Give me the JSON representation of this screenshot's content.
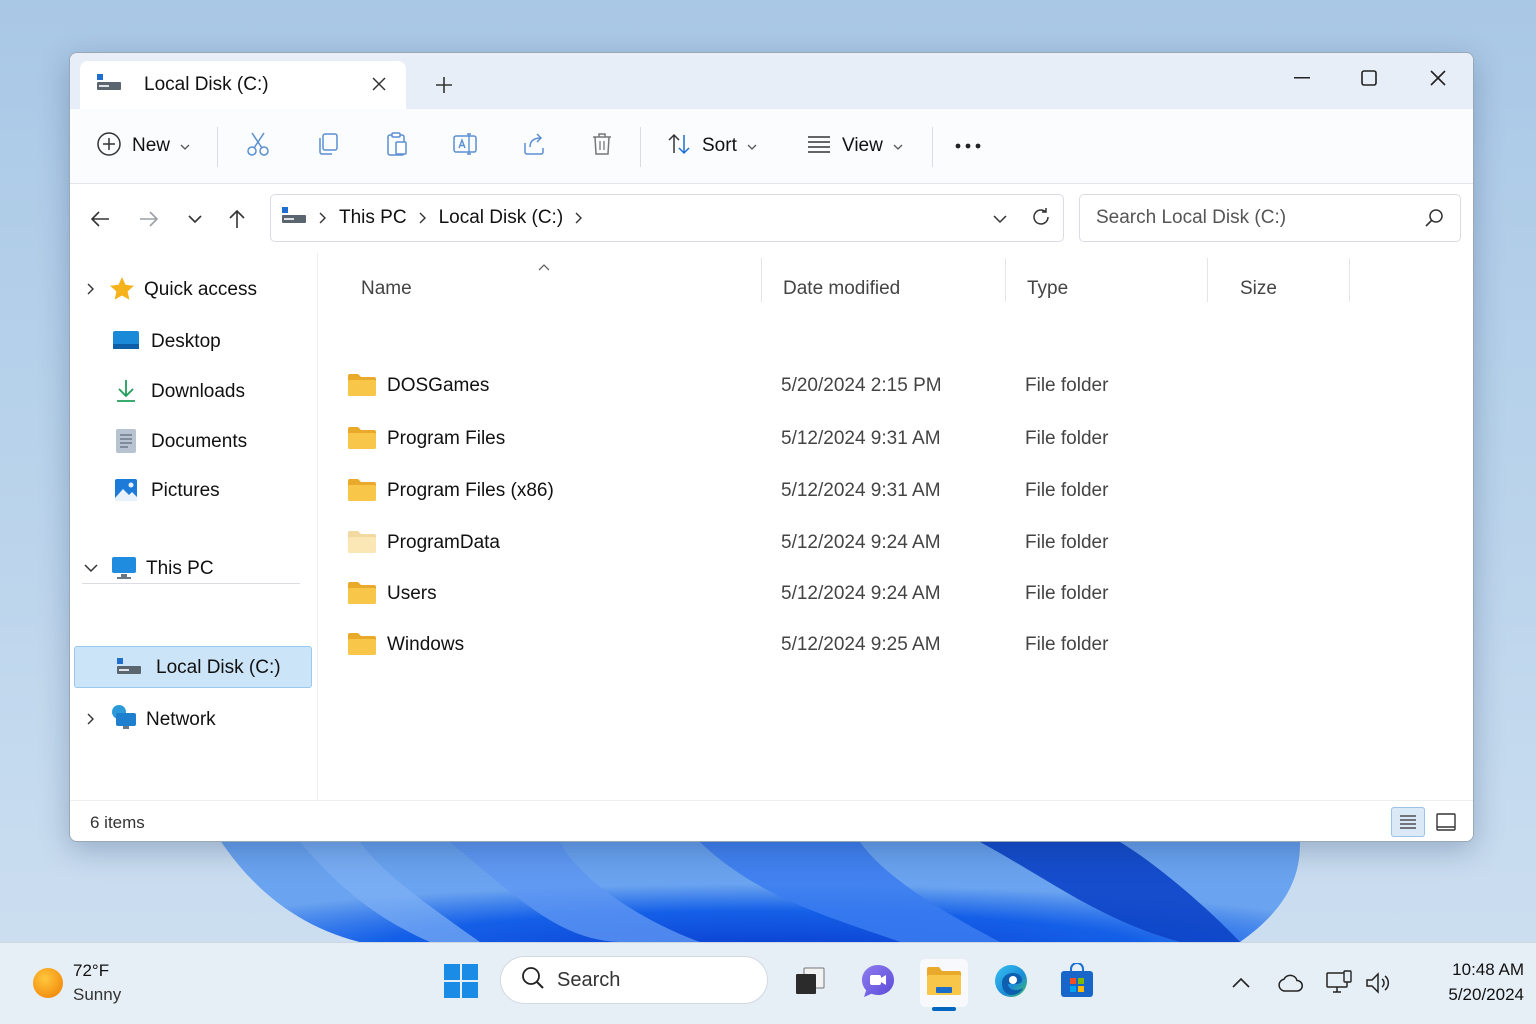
{
  "window": {
    "tab_title": "Local Disk (C:)",
    "controls": {
      "minimize": "minimize-icon",
      "maximize": "maximize-icon",
      "close": "close-icon"
    }
  },
  "toolbar": {
    "new_label": "New",
    "sort_label": "Sort",
    "view_label": "View",
    "icons": [
      "cut-icon",
      "copy-icon",
      "paste-icon",
      "rename-icon",
      "share-icon",
      "delete-icon",
      "more-icon"
    ]
  },
  "address": {
    "crumbs": [
      "This PC",
      "Local Disk (C:)"
    ]
  },
  "search": {
    "placeholder": "Search Local Disk (C:)"
  },
  "sidebar": {
    "items": [
      {
        "label": "Quick access"
      },
      {
        "label": "Desktop"
      },
      {
        "label": "Downloads"
      },
      {
        "label": "Documents"
      },
      {
        "label": "Pictures"
      },
      {
        "label": "This PC"
      },
      {
        "label": "Local Disk (C:)"
      },
      {
        "label": "Network"
      }
    ]
  },
  "columns": {
    "name": "Name",
    "date": "Date modified",
    "type": "Type",
    "size": "Size"
  },
  "files": [
    {
      "name": "DOSGames",
      "date": "5/20/2024  2:15 PM",
      "type": "File folder"
    },
    {
      "name": "Program Files",
      "date": "5/12/2024  9:31 AM",
      "type": "File folder"
    },
    {
      "name": "Program Files (x86)",
      "date": "5/12/2024  9:31 AM",
      "type": "File folder"
    },
    {
      "name": "ProgramData",
      "date": "5/12/2024  9:24 AM",
      "type": "File folder"
    },
    {
      "name": "Users",
      "date": "5/12/2024  9:24 AM",
      "type": "File folder"
    },
    {
      "name": "Windows",
      "date": "5/12/2024  9:25 AM",
      "type": "File folder"
    }
  ],
  "status": {
    "items": "6 items"
  },
  "taskbar": {
    "weather_temp": "72°F",
    "weather_cond": "Sunny",
    "search_label": "Search",
    "time": "10:48 AM",
    "date": "5/20/2024"
  },
  "colors": {
    "accent": "#0067c0",
    "selected": "#cce4f7",
    "folder": "#f8c74a"
  }
}
